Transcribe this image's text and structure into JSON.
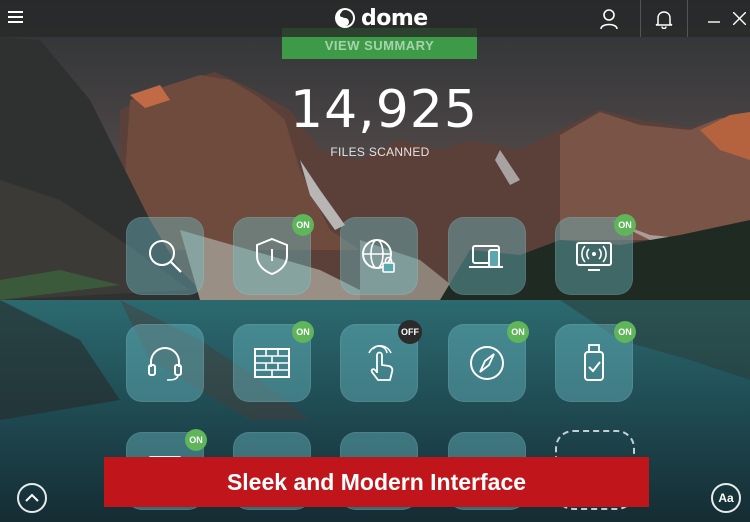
{
  "app": {
    "name": "dome"
  },
  "summary": {
    "button_label": "VIEW SUMMARY",
    "count": "14,925",
    "count_label": "FILES SCANNED"
  },
  "tiles": [
    {
      "name": "scan",
      "icon": "search-icon",
      "badge": ""
    },
    {
      "name": "antivirus",
      "icon": "shield-icon",
      "badge": "ON"
    },
    {
      "name": "safe-browsing",
      "icon": "globe-lock-icon",
      "badge": ""
    },
    {
      "name": "devices",
      "icon": "devices-icon",
      "badge": ""
    },
    {
      "name": "wifi-monitor",
      "icon": "wifi-monitor-icon",
      "badge": "ON"
    },
    {
      "name": "support",
      "icon": "headset-icon",
      "badge": ""
    },
    {
      "name": "firewall",
      "icon": "firewall-icon",
      "badge": "ON"
    },
    {
      "name": "behavioral-scan",
      "icon": "touch-icon",
      "badge": "OFF"
    },
    {
      "name": "navigation",
      "icon": "compass-icon",
      "badge": "ON"
    },
    {
      "name": "usb-protection",
      "icon": "usb-icon",
      "badge": "ON"
    },
    {
      "name": "bottom-tile-1",
      "icon": "tile-icon",
      "badge": "ON"
    },
    {
      "name": "bottom-tile-2",
      "icon": "tile-icon",
      "badge": ""
    },
    {
      "name": "bottom-tile-3",
      "icon": "tile-icon",
      "badge": ""
    },
    {
      "name": "bottom-tile-4",
      "icon": "tile-icon",
      "badge": ""
    }
  ],
  "banner": {
    "text": "Sleek and Modern Interface"
  },
  "font_button": {
    "label": "Aa"
  },
  "colors": {
    "accent_green": "#5fb55a",
    "banner_red": "#c0161b",
    "tile_bg": "#6ebec8"
  }
}
